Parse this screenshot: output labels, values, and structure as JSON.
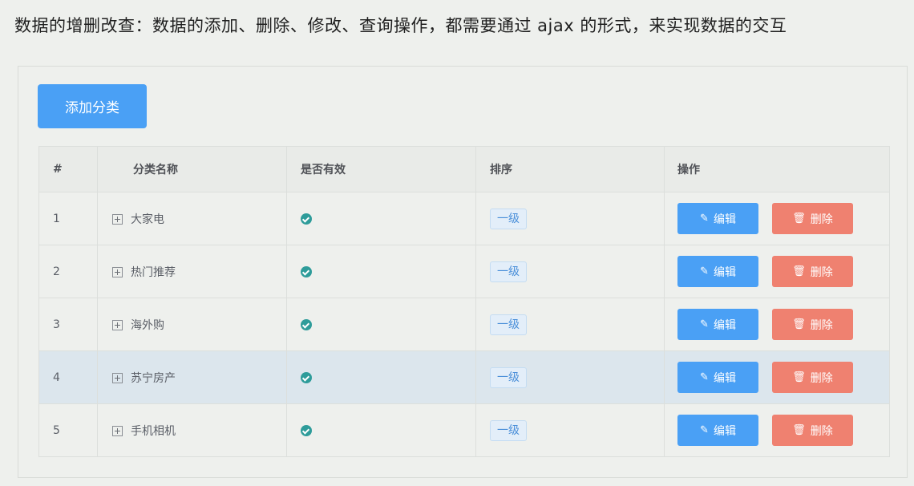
{
  "caption": "数据的增删改查：数据的添加、删除、修改、查询操作，都需要通过 ajax 的形式，来实现数据的交互",
  "toolbar": {
    "add_label": "添加分类"
  },
  "table": {
    "headers": {
      "index": "#",
      "name": "分类名称",
      "valid": "是否有效",
      "sort": "排序",
      "ops": "操作"
    },
    "rows": [
      {
        "index": "1",
        "name": "大家电",
        "level": "一级",
        "highlighted": false
      },
      {
        "index": "2",
        "name": "热门推荐",
        "level": "一级",
        "highlighted": false
      },
      {
        "index": "3",
        "name": "海外购",
        "level": "一级",
        "highlighted": false
      },
      {
        "index": "4",
        "name": "苏宁房产",
        "level": "一级",
        "highlighted": true
      },
      {
        "index": "5",
        "name": "手机相机",
        "level": "一级",
        "highlighted": false
      }
    ],
    "edit_label": "编辑",
    "delete_label": "删除"
  },
  "colors": {
    "primary": "#4aa0f5",
    "danger": "#ef8170",
    "success": "#2e9c9a",
    "highlight_row": "#dce6ed"
  },
  "icons": {
    "edit": "edit-icon",
    "delete": "trash-icon",
    "expand": "expand-plus-icon",
    "valid": "check-circle-icon"
  }
}
